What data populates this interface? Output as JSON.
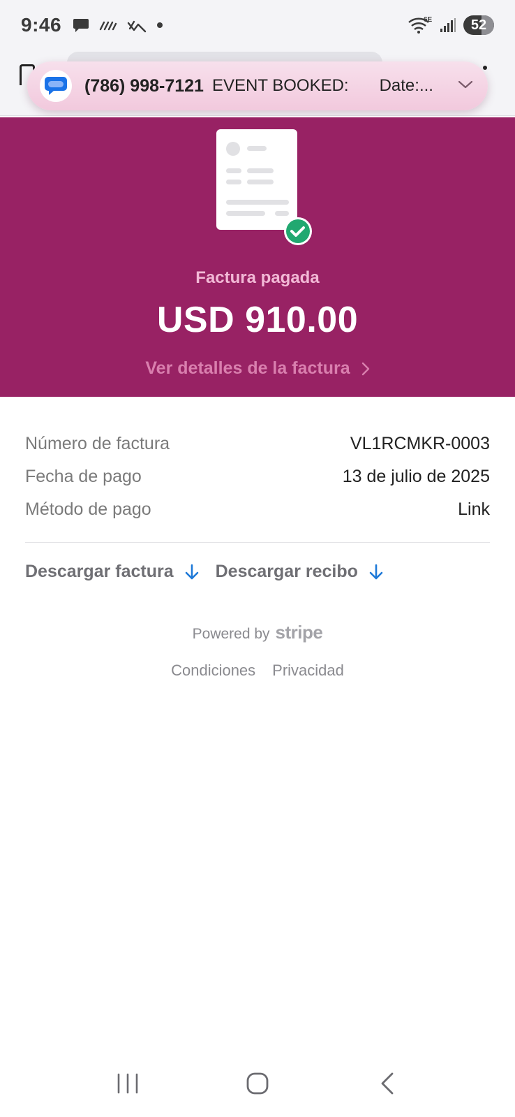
{
  "status_bar": {
    "time": "9:46",
    "network_label": "6E",
    "battery_level": "52",
    "icons": [
      "chat-bubble-icon",
      "voicemail-icon",
      "missed-call-icon",
      "dot-icon",
      "wifi-icon",
      "signal-icon",
      "battery-icon"
    ]
  },
  "notification": {
    "app_icon": "messages-icon",
    "sender": "(786) 998-7121",
    "text": "EVENT BOOKED:",
    "text_continued": "Date:...",
    "expand_icon": "chevron-down-icon",
    "background_color": "#f2c9dd"
  },
  "hero": {
    "illustration": "invoice-paid-icon",
    "status": "Factura pagada",
    "amount": "USD 910.00",
    "details_link": "Ver detalles de la factura",
    "background_color": "#982264"
  },
  "details": {
    "rows": [
      {
        "label": "Número de factura",
        "value": "VL1RCMKR-0003"
      },
      {
        "label": "Fecha de pago",
        "value": "13 de julio de 2025"
      },
      {
        "label": "Método de pago",
        "value": "Link"
      }
    ]
  },
  "downloads": {
    "invoice_label": "Descargar factura",
    "receipt_label": "Descargar recibo",
    "accent_color": "#1f7ad8"
  },
  "footer": {
    "powered_by": "Powered by",
    "brand": "stripe",
    "terms": "Condiciones",
    "privacy": "Privacidad"
  },
  "nav_bar": {
    "buttons": [
      "recents-icon",
      "home-icon",
      "back-icon"
    ]
  }
}
